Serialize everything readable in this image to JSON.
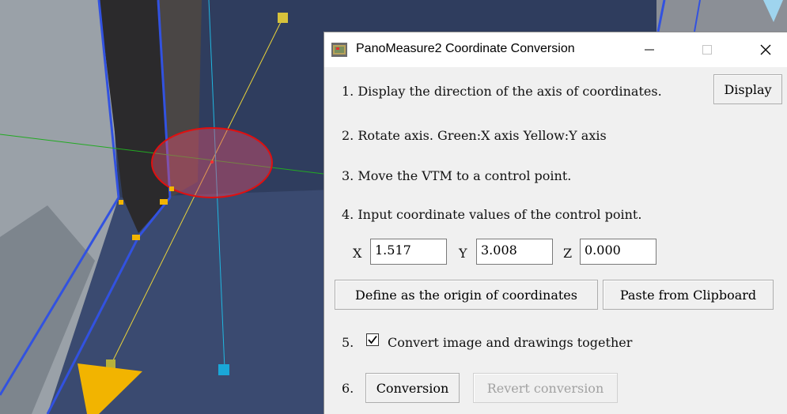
{
  "dialog": {
    "title": "PanoMeasure2 Coordinate Conversion",
    "step1_label": "1. Display the direction of the axis of coordinates.",
    "display_button": "Display",
    "step2_label": "2. Rotate axis. Green:X axis  Yellow:Y axis",
    "step3_label": "3. Move the VTM to a control point.",
    "step4_label": "4. Input coordinate values of the control point.",
    "coords": {
      "x_label": "X",
      "x_value": "1.517",
      "y_label": "Y",
      "y_value": "3.008",
      "z_label": "Z",
      "z_value": "0.000"
    },
    "define_origin_button": "Define as the origin of coordinates",
    "paste_clipboard_button": "Paste from Clipboard",
    "step5_number": "5.",
    "convert_together_label": "Convert image and drawings together",
    "convert_together_checked": true,
    "step6_number": "6.",
    "conversion_button": "Conversion",
    "revert_button": "Revert conversion"
  },
  "colors": {
    "highlight_ellipse": "#e01010",
    "x_axis": "#22aa22",
    "y_axis": "#e8d23a",
    "z_axis": "#20b7e0",
    "marker": "#f2b400"
  }
}
